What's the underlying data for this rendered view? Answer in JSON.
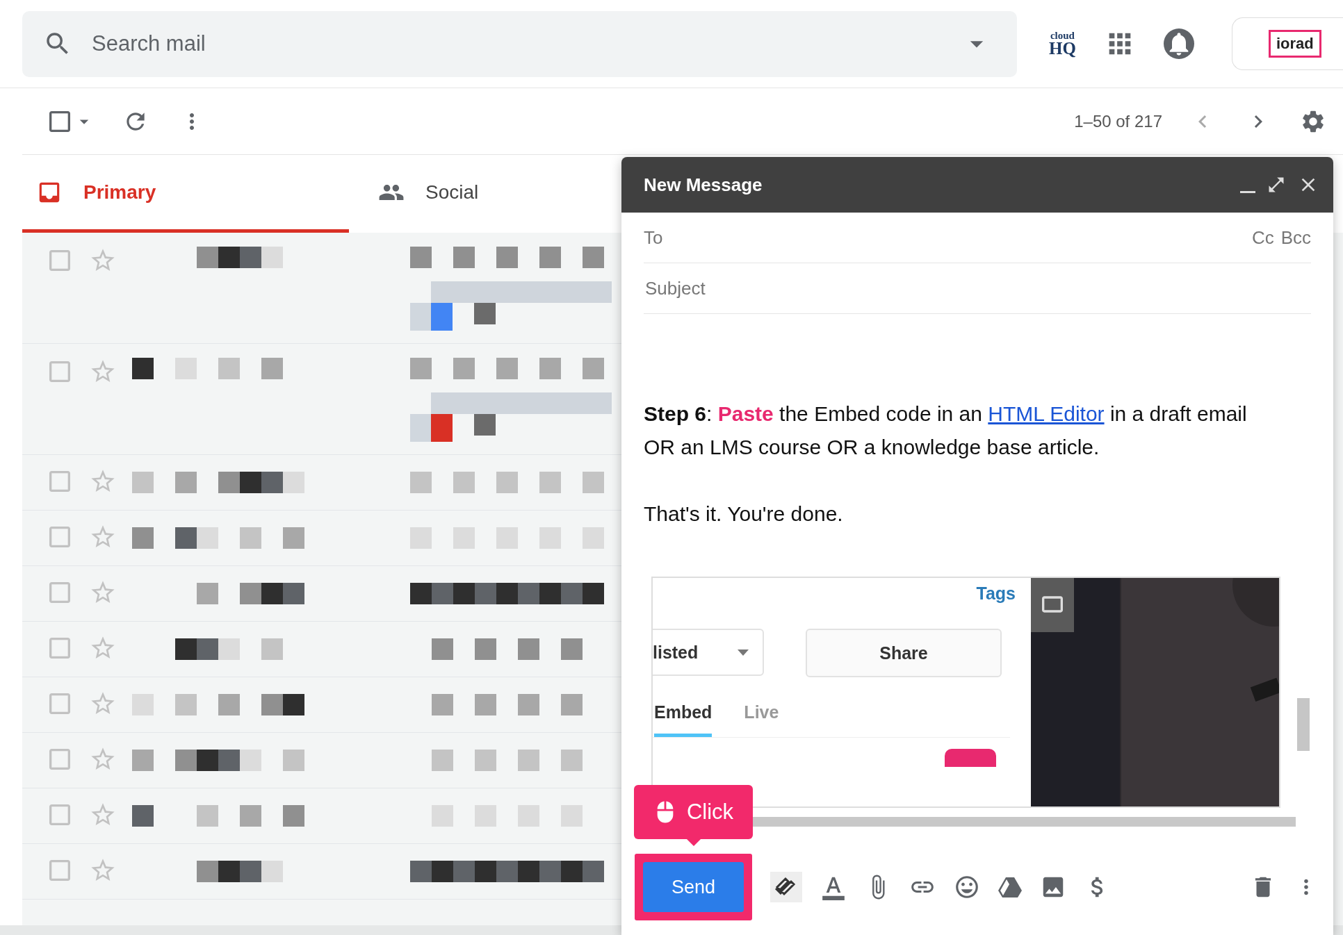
{
  "search": {
    "placeholder": "Search mail"
  },
  "header": {
    "cloudhq_logo": {
      "top": "cloud",
      "bottom": "HQ"
    },
    "account_logo": "iorad"
  },
  "toolbar": {
    "select_all_checked": false,
    "pagination": "1–50 of 217"
  },
  "tabs": [
    {
      "label": "Primary",
      "selected": true
    },
    {
      "label": "Social",
      "selected": false
    }
  ],
  "messages": [
    {
      "kind": "with-attachment",
      "checked": false,
      "starred": false
    },
    {
      "kind": "with-attachment",
      "checked": false,
      "starred": false
    },
    {
      "kind": "plain",
      "checked": false,
      "starred": false
    },
    {
      "kind": "plain",
      "checked": false,
      "starred": false
    },
    {
      "kind": "plain",
      "checked": false,
      "starred": false
    },
    {
      "kind": "plain",
      "checked": false,
      "starred": false
    },
    {
      "kind": "plain",
      "checked": false,
      "starred": false
    },
    {
      "kind": "plain",
      "checked": false,
      "starred": false
    },
    {
      "kind": "plain",
      "checked": false,
      "starred": false
    },
    {
      "kind": "plain",
      "checked": false,
      "starred": false
    }
  ],
  "compose": {
    "title": "New Message",
    "to_label": "To",
    "cc": "Cc",
    "bcc": "Bcc",
    "subject_placeholder": "Subject",
    "body": [
      [
        {
          "kind": "bold",
          "text": "Step 6"
        },
        {
          "kind": "plain",
          "text": ": "
        },
        {
          "kind": "highlight",
          "text": "Paste"
        },
        {
          "kind": "plain",
          "text": " the Embed code in an "
        },
        {
          "kind": "link",
          "text": "HTML Editor"
        },
        {
          "kind": "plain",
          "text": " in a draft email OR an LMS course OR a knowledge base article."
        }
      ],
      [
        {
          "kind": "plain",
          "text": "That's it. You're done."
        }
      ]
    ],
    "embed": {
      "link": "Tags",
      "visibility": "listed",
      "share": "Share",
      "tabs": [
        {
          "label": "Embed",
          "selected": true
        },
        {
          "label": "Live",
          "selected": false
        }
      ]
    },
    "tooltip": "Click",
    "send": "Send"
  }
}
